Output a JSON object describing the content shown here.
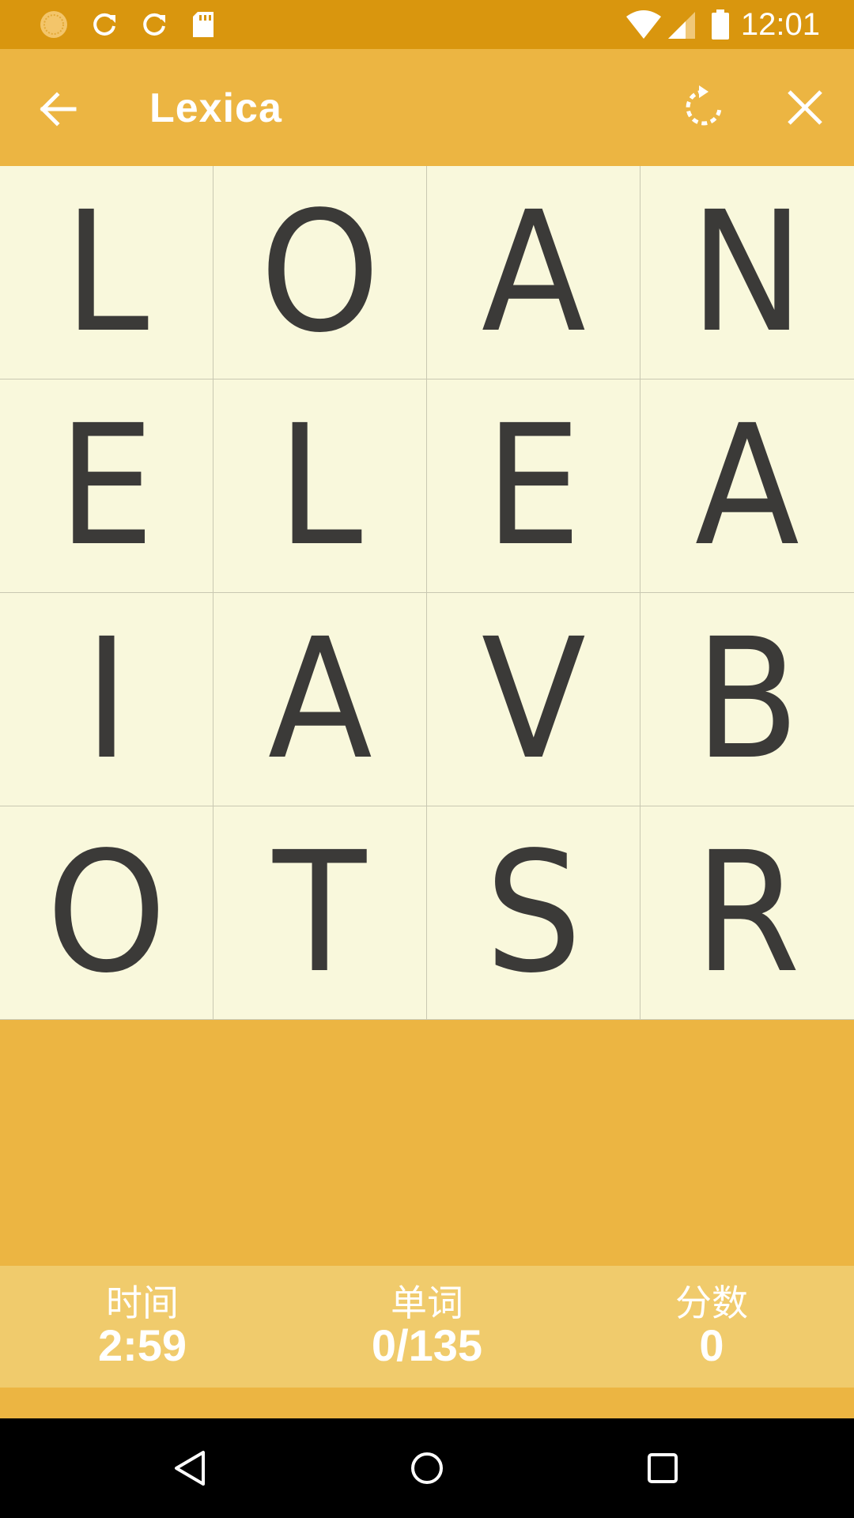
{
  "status_bar": {
    "time": "12:01",
    "icons": [
      "loading-circle-icon",
      "sync-icon",
      "sync-icon",
      "sd-card-icon",
      "wifi-icon",
      "cell-signal-icon",
      "battery-icon"
    ]
  },
  "app_bar": {
    "title": "Lexica",
    "back_icon": "arrow-back-icon",
    "rotate_icon": "rotate-icon",
    "close_icon": "close-icon"
  },
  "board": {
    "letters": [
      "L",
      "O",
      "A",
      "N",
      "E",
      "L",
      "E",
      "A",
      "I",
      "A",
      "V",
      "B",
      "O",
      "T",
      "S",
      "R"
    ]
  },
  "stats": {
    "time_label": "时间",
    "time_value": "2:59",
    "words_label": "单词",
    "words_value": "0/135",
    "score_label": "分数",
    "score_value": "0"
  },
  "nav_bar": {
    "icons": [
      "back-triangle-icon",
      "home-circle-icon",
      "recents-square-icon"
    ]
  },
  "colors": {
    "status_bar": "#D9960E",
    "app_bar": "#ECB542",
    "board_cell": "#F9F8DC",
    "letter": "#3B3A38",
    "score_bar": "#F0CB6C"
  }
}
